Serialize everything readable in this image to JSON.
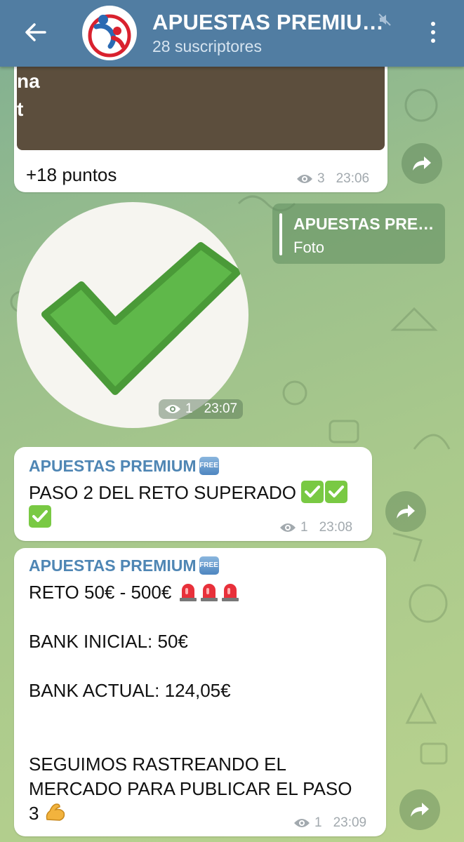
{
  "header": {
    "title": "APUESTAS PREMIU…",
    "subtitle": "28 suscriptores"
  },
  "messages": {
    "m1": {
      "image_text_line1": "na",
      "image_text_line2": "t",
      "text": "+18 puntos",
      "views": "3",
      "time": "23:06"
    },
    "m2": {
      "views": "1",
      "time": "23:07"
    },
    "reply_preview": {
      "title": "APUESTAS PRE…",
      "subtitle": "Foto"
    },
    "m3": {
      "sender": "APUESTAS PREMIUM",
      "badge": "FREE",
      "line1": "PASO 2 DEL RETO SUPERADO",
      "views": "1",
      "time": "23:08"
    },
    "m4": {
      "sender": "APUESTAS PREMIUM",
      "badge": "FREE",
      "line1": "RETO 50€ - 500€",
      "line2": "BANK INICIAL: 50€",
      "line3": "BANK ACTUAL: 124,05€",
      "line4": "SEGUIMOS RASTREANDO EL",
      "line5": "MERCADO PARA PUBLICAR EL PASO",
      "line6": "3",
      "views": "1",
      "time": "23:09"
    }
  },
  "icons": {
    "back": "arrow-left-icon",
    "mute": "muted-speaker-icon",
    "menu": "more-vertical-icon",
    "views": "eye-icon",
    "share": "share-arrow-icon"
  },
  "colors": {
    "header": "#517da2",
    "sender": "#4f86b4",
    "check": "#5fb84a"
  }
}
